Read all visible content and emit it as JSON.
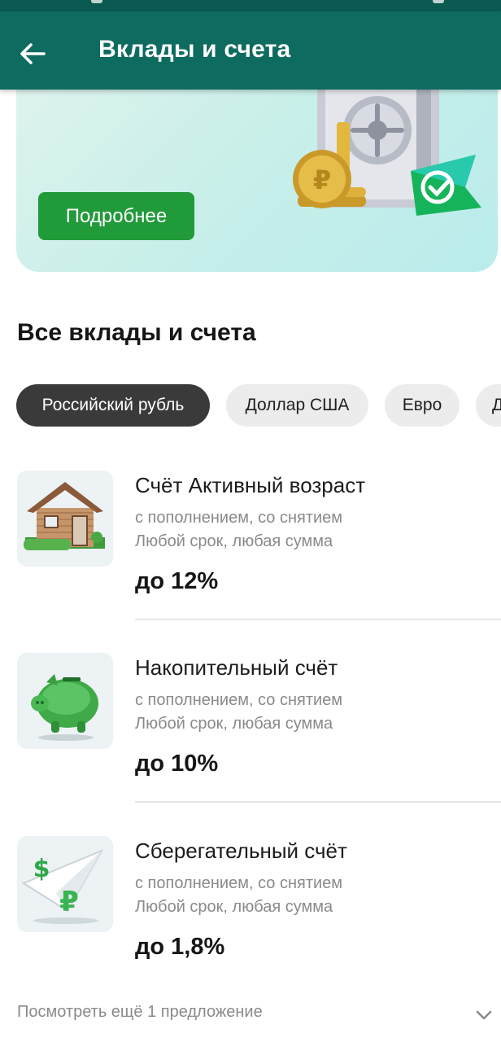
{
  "header": {
    "title": "Вклады и счета",
    "back_icon": "arrow-left-icon"
  },
  "banner": {
    "button_label": "Подробнее",
    "image": "safe-with-coins-illustration"
  },
  "section": {
    "title": "Все вклады и счета"
  },
  "currency_chips": [
    {
      "label": "Российский рубль",
      "selected": true
    },
    {
      "label": "Доллар США",
      "selected": false
    },
    {
      "label": "Евро",
      "selected": false
    },
    {
      "label": "Д",
      "selected": false
    }
  ],
  "offers": [
    {
      "title": "Счёт Активный возраст",
      "line1": "с пополнением, со снятием",
      "line2": "Любой срок, любая сумма",
      "rate": "до 12%",
      "icon": "house-icon"
    },
    {
      "title": "Накопительный счёт",
      "line1": "с пополнением, со снятием",
      "line2": "Любой срок, любая сумма",
      "rate": "до 10%",
      "icon": "piggy-bank-icon"
    },
    {
      "title": "Сберегательный счёт",
      "line1": "с пополнением, со снятием",
      "line2": "Любой срок, любая сумма",
      "rate": "до 1,8%",
      "icon": "paper-plane-currency-icon"
    }
  ],
  "footer": {
    "see_more": "Посмотреть ещё 1 предложение",
    "chevron_icon": "chevron-down-icon"
  },
  "colors": {
    "app_bar": "#0e6b5f",
    "accent_button": "#219a3a",
    "chip_selected": "#3a3a3a",
    "chip_default": "#ececec"
  }
}
